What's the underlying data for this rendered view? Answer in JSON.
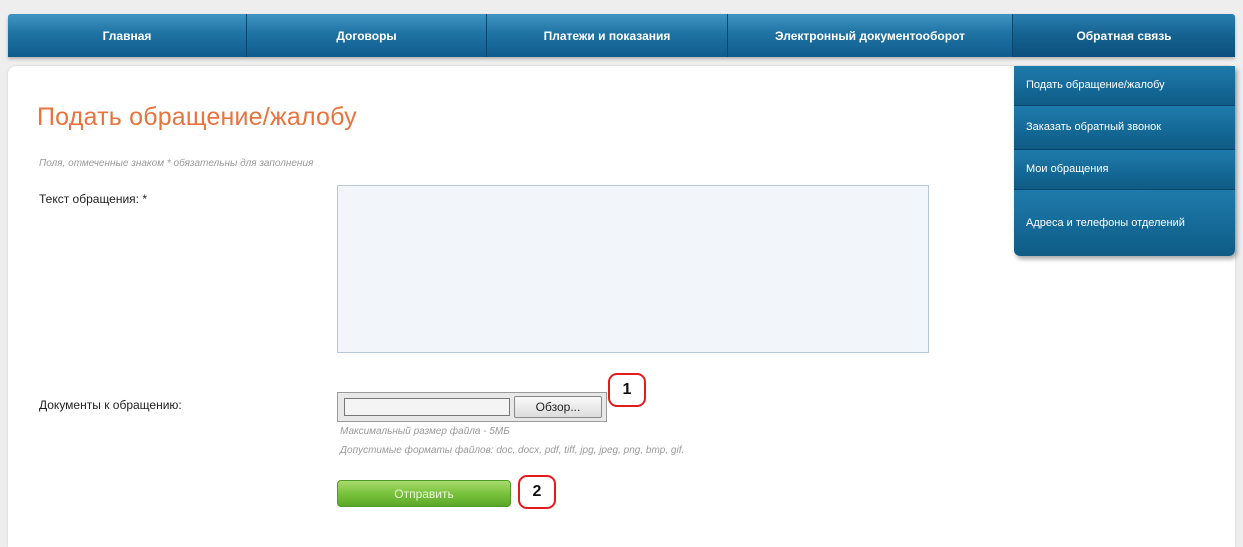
{
  "nav": {
    "items": [
      {
        "label": "Главная"
      },
      {
        "label": "Договоры"
      },
      {
        "label": "Платежи и показания"
      },
      {
        "label": "Электронный документооборот"
      },
      {
        "label": "Обратная связь"
      }
    ]
  },
  "dropdown": {
    "items": [
      {
        "label": "Подать обращение/жалобу"
      },
      {
        "label": "Заказать обратный звонок"
      },
      {
        "label": "Мои обращения"
      },
      {
        "label": "Адреса и телефоны отделений"
      }
    ]
  },
  "form": {
    "title": "Подать обращение/жалобу",
    "required_hint": "Поля, отмеченные знаком * обязательны для заполнения",
    "text_label": "Текст обращения: *",
    "text_value": "",
    "docs_label": "Документы к обращению:",
    "browse_label": "Обзор...",
    "max_size_note": "Максимальный размер файла - 5МБ",
    "formats_note": "Допустимые форматы файлов: doc, docx, pdf, tiff, jpg, jpeg, png, bmp, gif.",
    "submit_label": "Отправить"
  },
  "annotations": {
    "callout1": "1",
    "callout2": "2",
    "color": "#e21c1c"
  },
  "colors": {
    "accent_title": "#e8733d",
    "nav_blue": "#1f73a3",
    "submit_green": "#79c23c"
  }
}
